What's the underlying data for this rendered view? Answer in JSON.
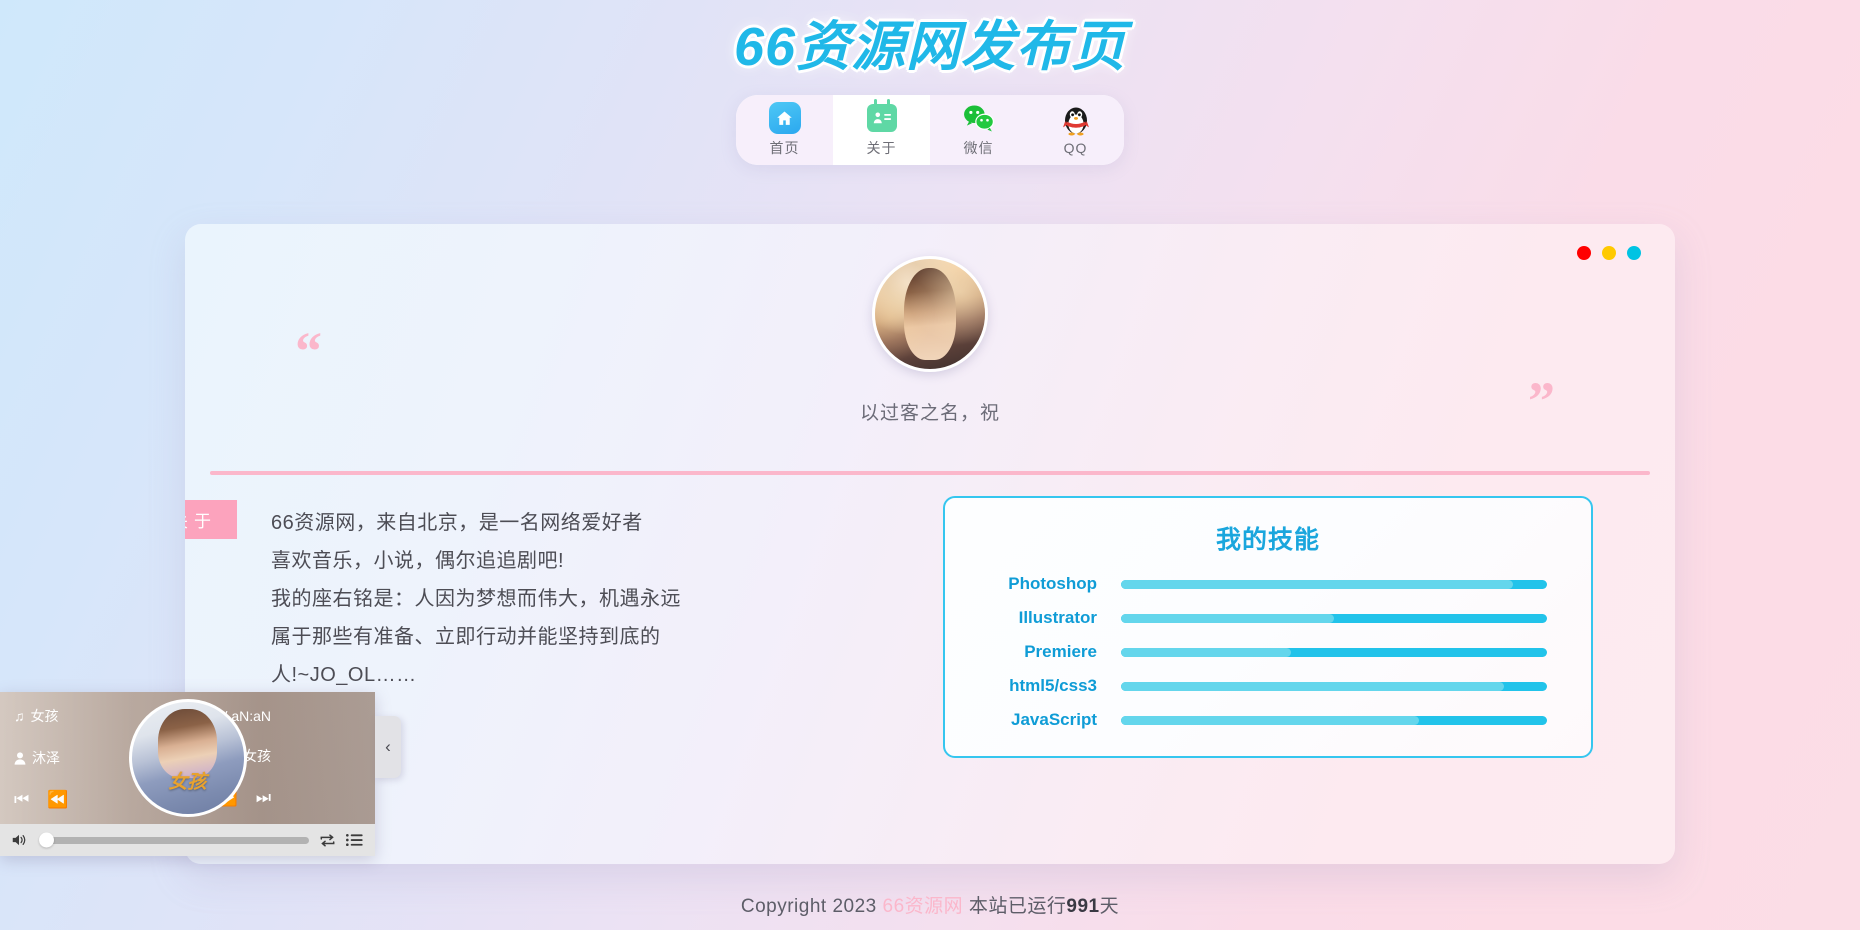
{
  "site": {
    "title": "66资源网发布页"
  },
  "nav": {
    "items": [
      {
        "label": "首页",
        "icon": "home-icon",
        "active": false
      },
      {
        "label": "关于",
        "icon": "id-card-icon",
        "active": true
      },
      {
        "label": "微信",
        "icon": "wechat-icon",
        "active": false
      },
      {
        "label": "QQ",
        "icon": "qq-penguin-icon",
        "active": false
      }
    ]
  },
  "window_controls": {
    "close_color": "#ff0000",
    "minimize_color": "#ffc900",
    "maximize_color": "#00c3e3"
  },
  "profile": {
    "avatar_alt": "avatar",
    "quote": "以过客之名，祝",
    "quote_open": "“",
    "quote_close": "”"
  },
  "about": {
    "tag": "关于",
    "lines": [
      "66资源网，来自北京，是一名网络爱好者",
      "喜欢音乐，小说，偶尔追追剧吧!",
      "我的座右铭是：人因为梦想而伟大，机遇永远",
      "属于那些有准备、立即行动并能坚持到底的",
      "人!~JO_OL……"
    ]
  },
  "skills": {
    "title": "我的技能",
    "track_color": "#22c3ea",
    "fill_color": "#64d6ec",
    "items": [
      {
        "name": "Photoshop",
        "percent": 92
      },
      {
        "name": "Illustrator",
        "percent": 50
      },
      {
        "name": "Premiere",
        "percent": 40
      },
      {
        "name": "html5/css3",
        "percent": 90
      },
      {
        "name": "JavaScript",
        "percent": 70
      }
    ]
  },
  "player": {
    "song": "女孩",
    "artist": "沐泽",
    "time": "00:00 / aN:aN",
    "album": "女孩",
    "cover_text": "女孩",
    "volume_percent": 0,
    "controls": {
      "first": "⏮",
      "prev": "⏪",
      "next": "⏩",
      "last": "⏭",
      "volume": "🔊",
      "repeat": "🔁",
      "playlist": "☰",
      "collapse": "‹"
    }
  },
  "footer": {
    "prefix": "Copyright 2023 ",
    "brand": "66资源网",
    "middle": " 本站已运行",
    "days": "991",
    "suffix": "天"
  }
}
